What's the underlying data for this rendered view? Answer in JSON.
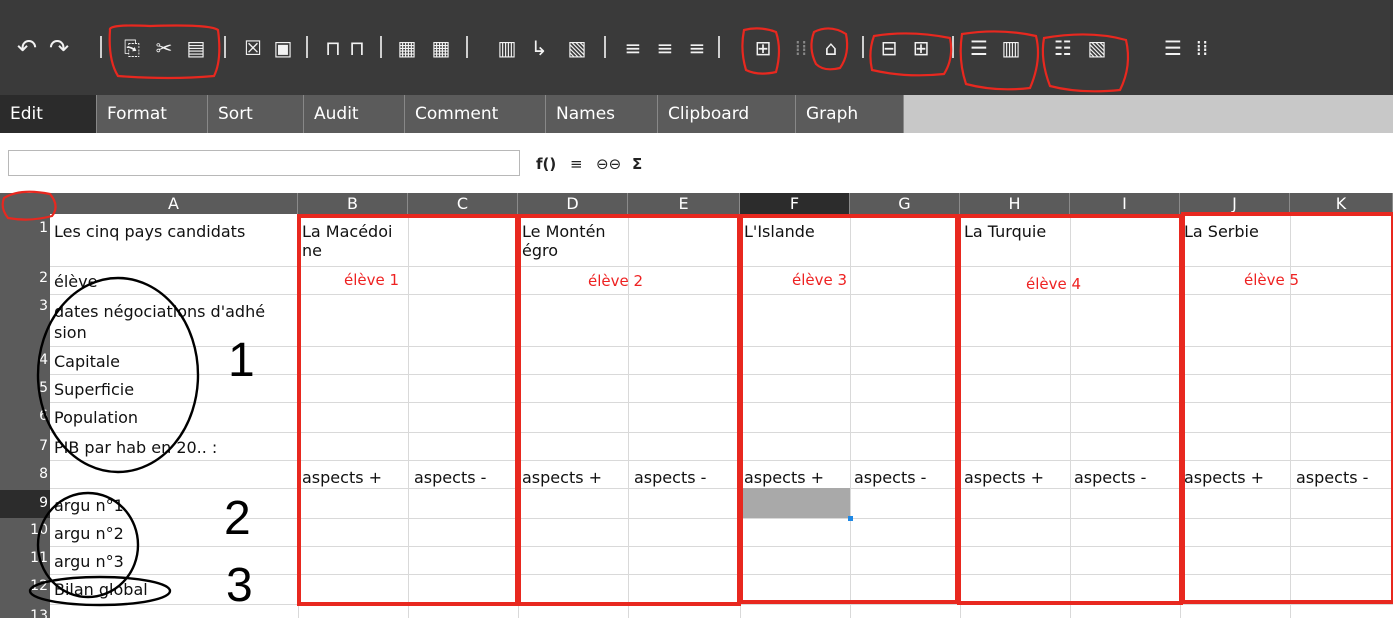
{
  "toolbar": {
    "icons": [
      {
        "name": "undo-icon",
        "glyph": "↶"
      },
      {
        "name": "redo-icon",
        "glyph": "↷"
      },
      {
        "name": "copy-icon",
        "glyph": "⎘"
      },
      {
        "name": "cut-icon",
        "glyph": "✂"
      },
      {
        "name": "paste-icon",
        "glyph": "📋"
      },
      {
        "name": "clear-icon",
        "glyph": "☒"
      },
      {
        "name": "paste-special-icon",
        "glyph": "⊞"
      },
      {
        "name": "lock-icon",
        "glyph": "🔒"
      },
      {
        "name": "unlock-icon",
        "glyph": "🔓"
      }
    ]
  },
  "tabs": [
    "Edit",
    "Format",
    "Sort",
    "Audit",
    "Comment",
    "Names",
    "Clipboard",
    "Graph"
  ],
  "formula_bar": {
    "icons": [
      "f()",
      "≡",
      "⊖⊖",
      "Σ"
    ]
  },
  "columns": [
    "A",
    "B",
    "C",
    "D",
    "E",
    "F",
    "G",
    "H",
    "I",
    "J",
    "K"
  ],
  "rows": [
    "1",
    "2",
    "3",
    "4",
    "5",
    "6",
    "7",
    "8",
    "9",
    "10",
    "11",
    "12",
    "13"
  ],
  "cells": {
    "a1": "Les cinq pays candidats",
    "b1a": "La Macédoi",
    "b1b": "ne",
    "d1a": "Le Montén",
    "d1b": "égro",
    "f1": "L'Islande",
    "h1": "La Turquie",
    "j1": "La Serbie",
    "a2": "élève",
    "b2": "élève 1",
    "d2": "élève 2",
    "f2": "élève 3",
    "h2": "élève 4",
    "j2": "élève 5",
    "a3a": "dates négociations d'adhé",
    "a3b": "sion",
    "a4": "Capitale",
    "a5": "Superficie",
    "a6": "Population",
    "a7": "PIB par hab en 20.. :",
    "aspects_plus": "aspects +",
    "aspects_minus": "aspects -",
    "a9": "argu n°1",
    "a10": "argu n°2",
    "a11": "argu n°3",
    "a12": "Bilan global"
  },
  "annotations": {
    "n1": "1",
    "n2": "2",
    "n3": "3"
  },
  "colors": {
    "annotation_red": "#e8281f",
    "header_dark": "#3a3a3a"
  }
}
